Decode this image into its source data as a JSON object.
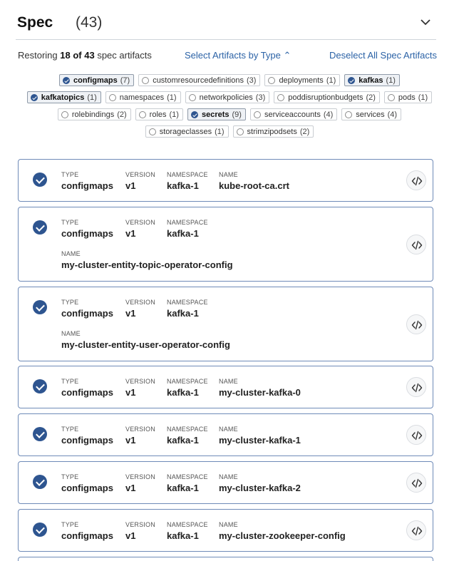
{
  "header": {
    "title": "Spec",
    "count": "(43)"
  },
  "toolbar": {
    "summary_prefix": "Restoring",
    "summary_selected": "18 of 43",
    "summary_suffix": "spec artifacts",
    "select_by_type": "Select Artifacts by Type ⌃",
    "deselect_all": "Deselect All Spec Artifacts"
  },
  "chip_rows": [
    [
      {
        "label": "configmaps",
        "count": "(7)",
        "selected": true
      },
      {
        "label": "customresourcedefinitions",
        "count": "(3)",
        "selected": false
      },
      {
        "label": "deployments",
        "count": "(1)",
        "selected": false
      },
      {
        "label": "kafkas",
        "count": "(1)",
        "selected": true
      }
    ],
    [
      {
        "label": "kafkatopics",
        "count": "(1)",
        "selected": true
      },
      {
        "label": "namespaces",
        "count": "(1)",
        "selected": false
      },
      {
        "label": "networkpolicies",
        "count": "(3)",
        "selected": false
      },
      {
        "label": "poddisruptionbudgets",
        "count": "(2)",
        "selected": false
      },
      {
        "label": "pods",
        "count": "(1)",
        "selected": false
      }
    ],
    [
      {
        "label": "rolebindings",
        "count": "(2)",
        "selected": false
      },
      {
        "label": "roles",
        "count": "(1)",
        "selected": false
      },
      {
        "label": "secrets",
        "count": "(9)",
        "selected": true
      },
      {
        "label": "serviceaccounts",
        "count": "(4)",
        "selected": false
      },
      {
        "label": "services",
        "count": "(4)",
        "selected": false
      }
    ],
    [
      {
        "label": "storageclasses",
        "count": "(1)",
        "selected": false
      },
      {
        "label": "strimzipodsets",
        "count": "(2)",
        "selected": false
      }
    ]
  ],
  "field_labels": {
    "type": "TYPE",
    "version": "VERSION",
    "namespace": "NAMESPACE",
    "name": "NAME"
  },
  "artifacts": [
    {
      "type": "configmaps",
      "version": "v1",
      "namespace": "kafka-1",
      "name": "kube-root-ca.crt"
    },
    {
      "type": "configmaps",
      "version": "v1",
      "namespace": "kafka-1",
      "name": "my-cluster-entity-topic-operator-config"
    },
    {
      "type": "configmaps",
      "version": "v1",
      "namespace": "kafka-1",
      "name": "my-cluster-entity-user-operator-config"
    },
    {
      "type": "configmaps",
      "version": "v1",
      "namespace": "kafka-1",
      "name": "my-cluster-kafka-0"
    },
    {
      "type": "configmaps",
      "version": "v1",
      "namespace": "kafka-1",
      "name": "my-cluster-kafka-1"
    },
    {
      "type": "configmaps",
      "version": "v1",
      "namespace": "kafka-1",
      "name": "my-cluster-kafka-2"
    },
    {
      "type": "configmaps",
      "version": "v1",
      "namespace": "kafka-1",
      "name": "my-cluster-zookeeper-config"
    }
  ],
  "colors": {
    "accent": "#2e5590",
    "link": "#2b62a6",
    "card_border": "#6f8bb8"
  }
}
